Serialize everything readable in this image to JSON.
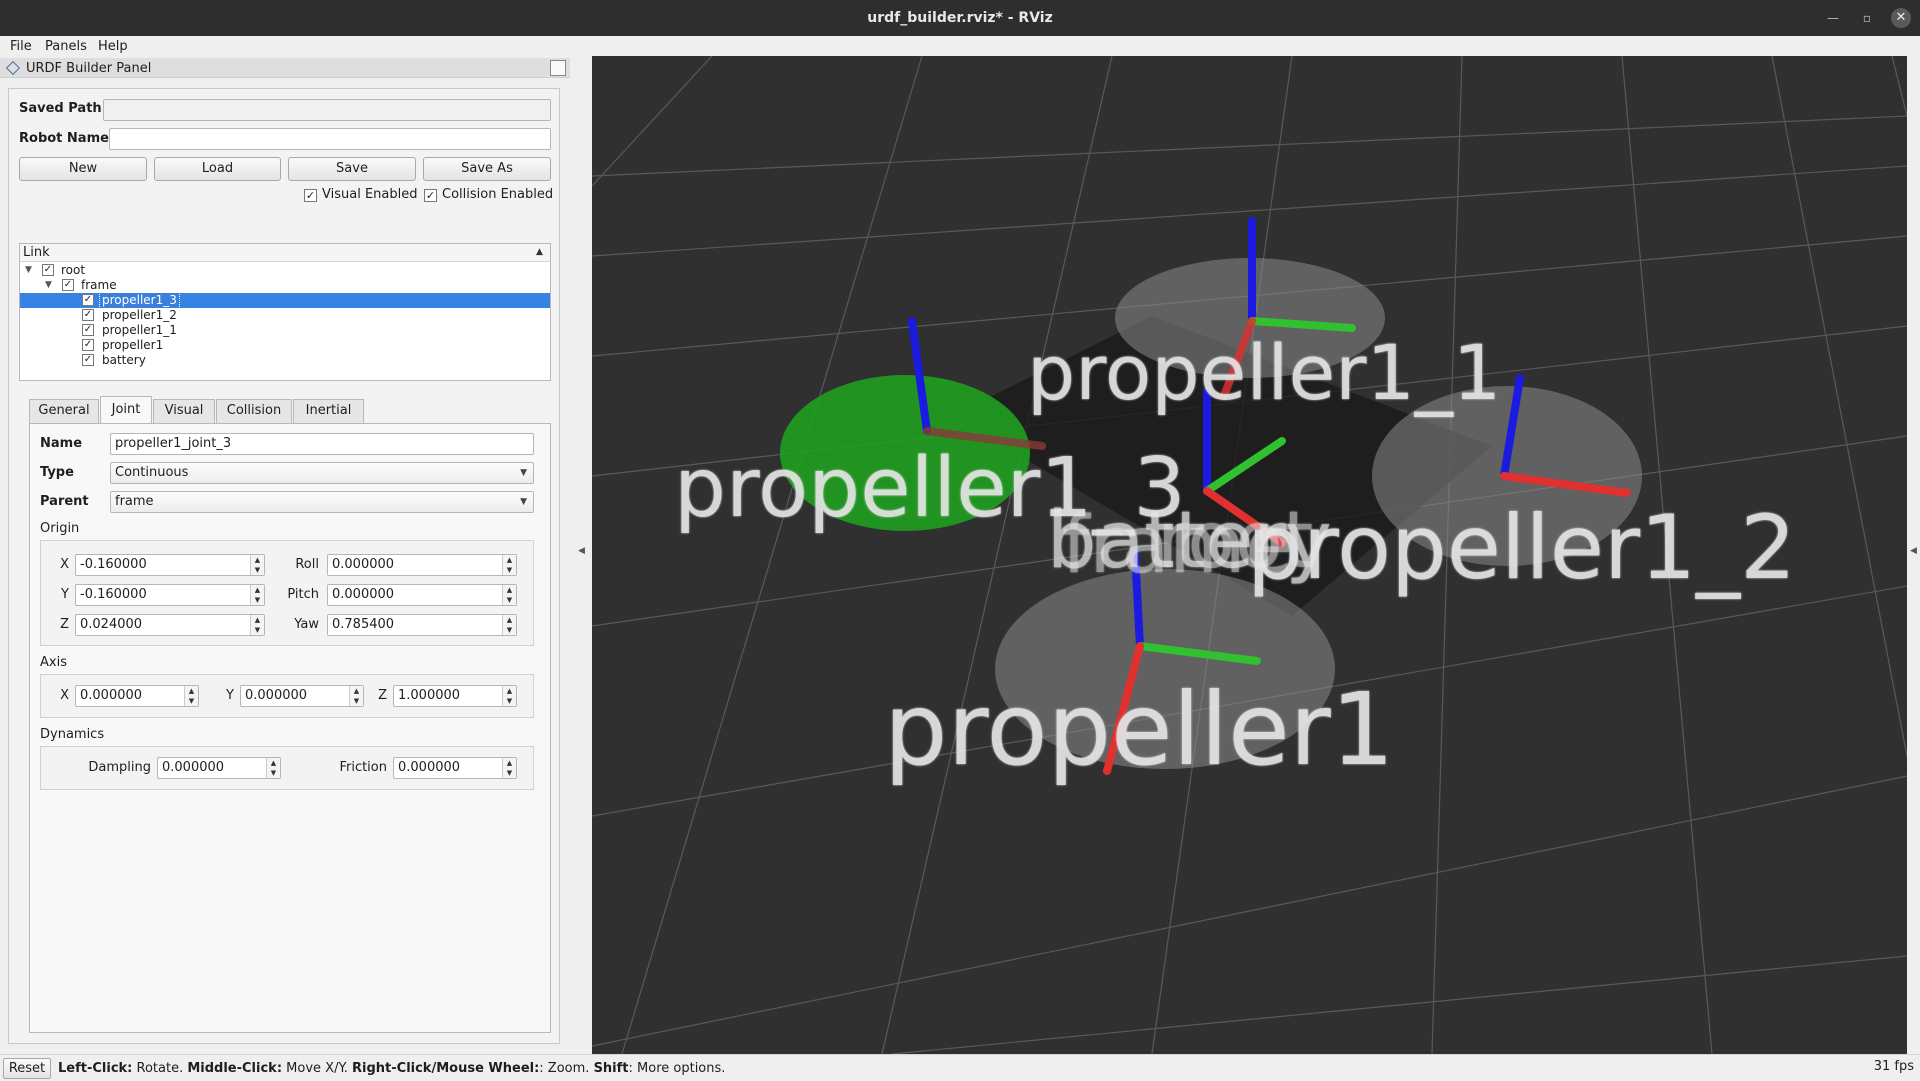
{
  "window": {
    "title": "urdf_builder.rviz* - RViz"
  },
  "menu": [
    "File",
    "Panels",
    "Help"
  ],
  "dock": {
    "title": "URDF Builder Panel"
  },
  "form": {
    "saved_path_label": "Saved Path",
    "saved_path_value": "",
    "robot_name_label": "Robot Name",
    "robot_name_value": "",
    "buttons": {
      "new": "New",
      "load": "Load",
      "save": "Save",
      "save_as": "Save As"
    },
    "visual_enabled": "Visual Enabled",
    "collision_enabled": "Collision Enabled"
  },
  "tree": {
    "header": "Link",
    "items": [
      "root",
      "frame",
      "propeller1_3",
      "propeller1_2",
      "propeller1_1",
      "propeller1",
      "battery"
    ]
  },
  "tabs": [
    "General",
    "Joint",
    "Visual",
    "Collision",
    "Inertial"
  ],
  "joint": {
    "name_label": "Name",
    "name_value": "propeller1_joint_3",
    "type_label": "Type",
    "type_value": "Continuous",
    "parent_label": "Parent",
    "parent_value": "frame",
    "origin_label": "Origin",
    "origin": {
      "x_label": "X",
      "x": "-0.160000",
      "y_label": "Y",
      "y": "-0.160000",
      "z_label": "Z",
      "z": "0.024000",
      "roll_label": "Roll",
      "roll": "0.000000",
      "pitch_label": "Pitch",
      "pitch": "0.000000",
      "yaw_label": "Yaw",
      "yaw": "0.785400"
    },
    "axis_label": "Axis",
    "axis": {
      "x_label": "X",
      "x": "0.000000",
      "y_label": "Y",
      "y": "0.000000",
      "z_label": "Z",
      "z": "1.000000"
    },
    "dynamics_label": "Dynamics",
    "dynamics": {
      "damping_label": "Dampling",
      "damping": "0.000000",
      "friction_label": "Friction",
      "friction": "0.000000"
    }
  },
  "viewport": {
    "labels": [
      "propeller1_1",
      "propeller1_3",
      "propeller1_2",
      "propeller1",
      "battery",
      "frame",
      "root"
    ],
    "colors": {
      "background": "#303030",
      "selected_disc": "#1fa01f",
      "x_axis": "#e03030",
      "y_axis": "#30c030",
      "z_axis": "#1a1ae0"
    }
  },
  "status": {
    "reset": "Reset",
    "hint_parts": [
      "Left-Click:",
      " Rotate. ",
      "Middle-Click:",
      " Move X/Y. ",
      "Right-Click/Mouse Wheel:",
      ": Zoom. ",
      "Shift",
      ": More options."
    ],
    "fps": "31 fps"
  }
}
